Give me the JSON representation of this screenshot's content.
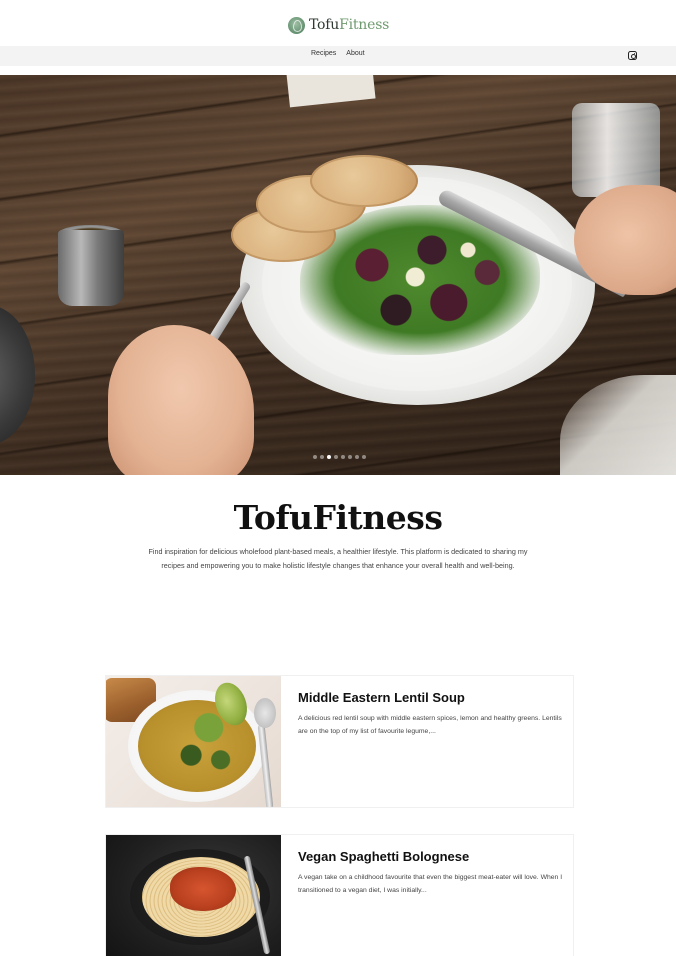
{
  "header": {
    "logo_part1": "Tofu",
    "logo_part2": "Fitness"
  },
  "nav": {
    "items": [
      {
        "label": "Recipes"
      },
      {
        "label": "About"
      }
    ],
    "social_icon": "instagram-icon"
  },
  "hero": {
    "slide_count": 8,
    "active_slide": 3
  },
  "intro": {
    "title": "TofuFitness",
    "description": "Find inspiration for delicious wholefood plant-based meals, a healthier lifestyle. This platform is dedicated to sharing my recipes and empowering you to make holistic lifestyle changes that enhance your overall health and well-being."
  },
  "recipes": [
    {
      "title": "Middle Eastern Lentil Soup",
      "excerpt": "A delicious red lentil soup with middle eastern spices, lemon and healthy greens. Lentils are on the top of my list of favourite legume,..."
    },
    {
      "title": "Vegan Spaghetti Bolognese",
      "excerpt": "A vegan take on a childhood favourite that even the biggest meat-eater will love. When I transitioned to a vegan diet, I was initially..."
    }
  ],
  "colors": {
    "brand_green": "#6f9a6f",
    "nav_bg": "#f3f3f3"
  }
}
